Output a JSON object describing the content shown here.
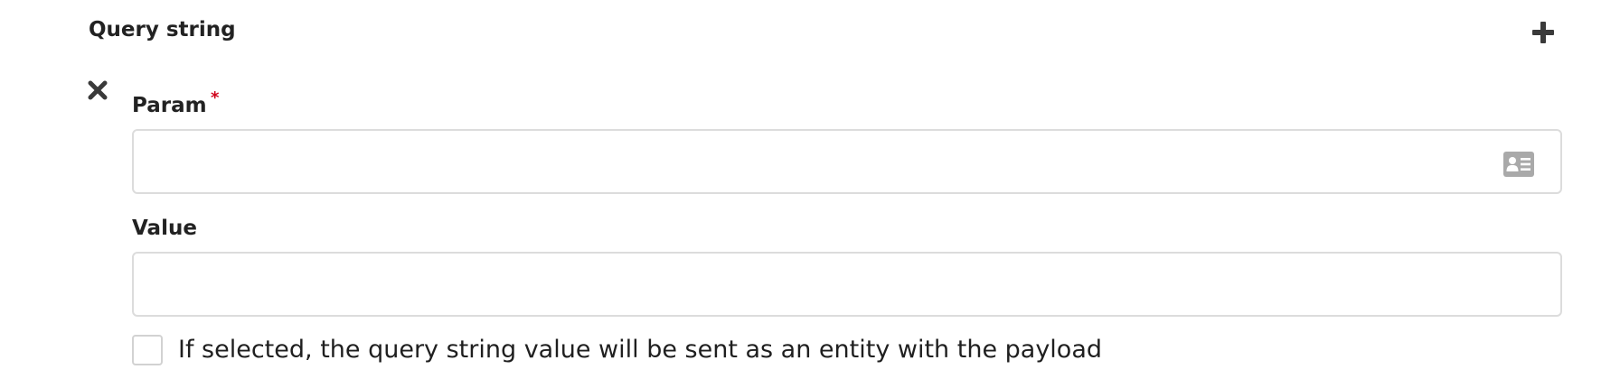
{
  "section": {
    "title": "Query string"
  },
  "param_field": {
    "label": "Param",
    "required_marker": "*",
    "value": "",
    "placeholder": ""
  },
  "value_field": {
    "label": "Value",
    "value": "",
    "placeholder": ""
  },
  "entity_checkbox": {
    "label": "If selected, the query string value will be sent as an entity with the payload",
    "checked": false
  },
  "icons": {
    "add": "plus-icon",
    "remove": "close-icon",
    "param_picker": "id-card-icon"
  },
  "colors": {
    "required": "#d0021b",
    "icon": "#3a3a3a",
    "border": "#dcdcdc"
  }
}
